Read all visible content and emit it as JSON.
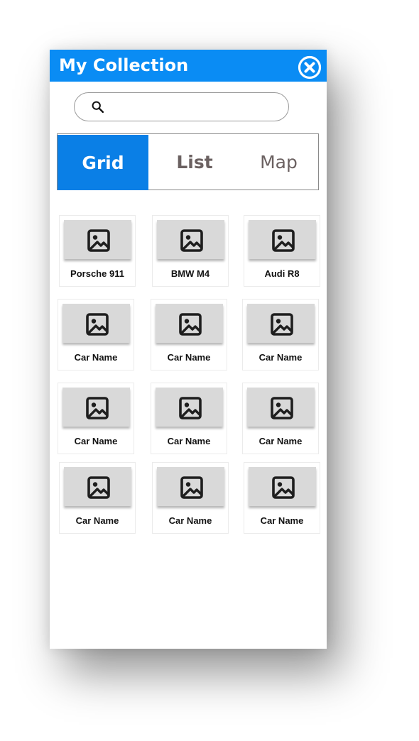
{
  "header": {
    "title": "My Collection",
    "close_icon": "close-circle-icon",
    "color": "#0a8cf4"
  },
  "search": {
    "icon": "search-icon",
    "value": "",
    "placeholder": ""
  },
  "tabs": {
    "active": "Grid",
    "active_color": "#0a7fe6",
    "items": [
      {
        "label": "Grid"
      },
      {
        "label": "List"
      },
      {
        "label": "Map"
      }
    ]
  },
  "grid": {
    "thumbnail_icon": "image-icon",
    "items": [
      {
        "name": "Porsche 911"
      },
      {
        "name": "BMW M4"
      },
      {
        "name": "Audi R8"
      },
      {
        "name": "Car Name"
      },
      {
        "name": "Car Name"
      },
      {
        "name": "Car Name"
      },
      {
        "name": "Car Name"
      },
      {
        "name": "Car Name"
      },
      {
        "name": "Car Name"
      },
      {
        "name": "Car Name"
      },
      {
        "name": "Car Name"
      },
      {
        "name": "Car Name"
      }
    ]
  }
}
